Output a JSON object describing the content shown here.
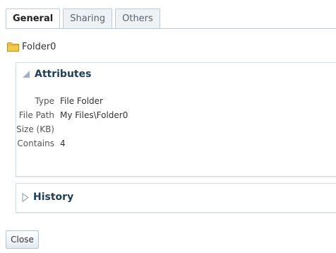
{
  "tabs": [
    {
      "label": "General",
      "active": true
    },
    {
      "label": "Sharing",
      "active": false
    },
    {
      "label": "Others",
      "active": false
    }
  ],
  "folder": {
    "name": "Folder0",
    "icon": "folder-icon"
  },
  "attributes": {
    "title": "Attributes",
    "expanded": true,
    "rows": [
      {
        "label": "Type",
        "value": "File Folder"
      },
      {
        "label": "File Path",
        "value": "My Files\\Folder0"
      },
      {
        "label": "Size (KB)",
        "value": ""
      },
      {
        "label": "Contains",
        "value": "4"
      }
    ]
  },
  "history": {
    "title": "History",
    "expanded": false
  },
  "buttons": {
    "close": "Close"
  },
  "colors": {
    "header_text": "#1d3e5c",
    "folder": "#f2c94c",
    "tab_border": "#c3cbd2"
  }
}
